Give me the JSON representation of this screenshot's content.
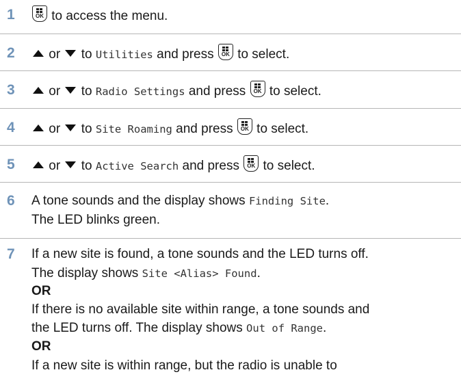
{
  "steps": [
    {
      "number": "1",
      "text": "to access the menu."
    },
    {
      "number": "2",
      "or": "or",
      "to": "to",
      "menu_item": "Utilities",
      "press": "and press",
      "tail": "to select."
    },
    {
      "number": "3",
      "or": "or",
      "to": "to",
      "menu_item": "Radio Settings",
      "press": "and press",
      "tail": "to select."
    },
    {
      "number": "4",
      "or": "or",
      "to": "to",
      "menu_item": "Site Roaming",
      "press": "and press",
      "tail": "to select."
    },
    {
      "number": "5",
      "or": "or",
      "to": "to",
      "menu_item": "Active Search",
      "press": "and press",
      "tail": "to select."
    },
    {
      "number": "6",
      "line1_text": "A tone sounds and the display shows",
      "line1_display": "Finding Site",
      "line1_end": ".",
      "line2": "The LED blinks green."
    },
    {
      "number": "7",
      "line1": "If a new site is found, a tone sounds and the LED turns off.",
      "line2_text": "The display shows",
      "line2_display": "Site <Alias> Found",
      "line2_end": ".",
      "or1": "OR",
      "line4": "If there is no available site within range, a tone sounds and",
      "line5_text": "the LED turns off. The display shows",
      "line5_display": "Out of Range",
      "line5_end": ".",
      "or2": "OR",
      "line7": "If a new site is within range, but the radio is unable to"
    }
  ],
  "icons": {
    "menu_ok": "menu-ok-button-icon",
    "up": "up-arrow-icon",
    "down": "down-arrow-icon"
  },
  "ok_label": "OK",
  "accent_color": "#6f93b8"
}
